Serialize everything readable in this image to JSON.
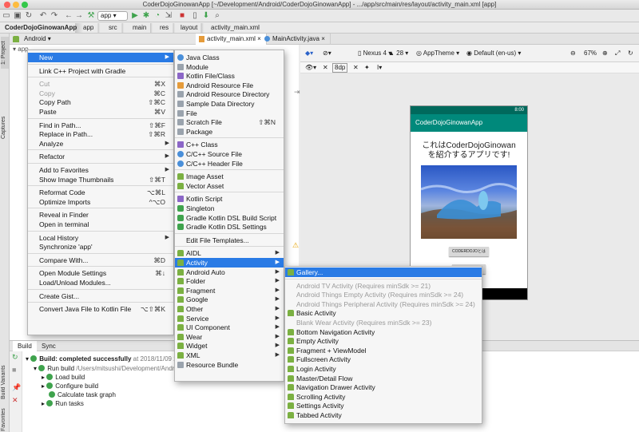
{
  "window": {
    "title": "CoderDojoGinowanApp [~/Development/Android/CoderDojoGinowanApp] - .../app/src/main/res/layout/activity_main.xml [app]"
  },
  "toolbar": {
    "run_config": "app"
  },
  "breadcrumbs": [
    "CoderDojoGinowanApp",
    "app",
    "src",
    "main",
    "res",
    "layout",
    "activity_main.xml"
  ],
  "left_strip": {
    "project": "1: Project",
    "captures": "Captures",
    "build_variants": "Build Variants",
    "favorites": "Favorites"
  },
  "project_panel": {
    "view_mode": "Android",
    "root": "app"
  },
  "editor_tabs": [
    "activity_main.xml",
    "MainActivity.java"
  ],
  "design_bar": {
    "device": "Nexus 4",
    "api": "28",
    "theme": "AppTheme",
    "locale": "Default (en-us)",
    "zoom": "67%",
    "margin": "8dp"
  },
  "preview": {
    "status_time": "8:00",
    "app_title": "CoderDojoGinowanApp",
    "hello_line1": "これはCoderDojoGinowan",
    "hello_line2": "を紹介するアプリです!",
    "button1": "CODERDOJOとは"
  },
  "bottom_tabs": [
    "Build",
    "Sync"
  ],
  "build_output": {
    "status": "Build: completed successfully",
    "status_time": "at 2018/11/09 20",
    "run_build": "Run build",
    "run_build_path": "/Users/mitsushi/Development/Andr",
    "steps": [
      "Load build",
      "Configure build",
      "Calculate task graph",
      "Run tasks"
    ]
  },
  "context_menu": [
    {
      "label": "New",
      "arrow": true,
      "highlight": true
    },
    {
      "sep": true
    },
    {
      "label": "Link C++ Project with Gradle"
    },
    {
      "sep": true
    },
    {
      "label": "Cut",
      "shortcut": "⌘X",
      "disabled": true
    },
    {
      "label": "Copy",
      "shortcut": "⌘C",
      "disabled": true
    },
    {
      "label": "Copy Path",
      "shortcut": "⇧⌘C"
    },
    {
      "label": "Paste",
      "shortcut": "⌘V"
    },
    {
      "sep": true
    },
    {
      "label": "Find in Path...",
      "shortcut": "⇧⌘F"
    },
    {
      "label": "Replace in Path...",
      "shortcut": "⇧⌘R"
    },
    {
      "label": "Analyze",
      "arrow": true
    },
    {
      "sep": true
    },
    {
      "label": "Refactor",
      "arrow": true
    },
    {
      "sep": true
    },
    {
      "label": "Add to Favorites",
      "arrow": true
    },
    {
      "label": "Show Image Thumbnails",
      "shortcut": "⇧⌘T"
    },
    {
      "sep": true
    },
    {
      "label": "Reformat Code",
      "shortcut": "⌥⌘L"
    },
    {
      "label": "Optimize Imports",
      "shortcut": "^⌥O"
    },
    {
      "sep": true
    },
    {
      "label": "Reveal in Finder"
    },
    {
      "label": "Open in terminal"
    },
    {
      "sep": true
    },
    {
      "label": "Local History",
      "arrow": true
    },
    {
      "label": "Synchronize 'app'"
    },
    {
      "sep": true
    },
    {
      "label": "Compare With...",
      "shortcut": "⌘D"
    },
    {
      "sep": true
    },
    {
      "label": "Open Module Settings",
      "shortcut": "⌘↓"
    },
    {
      "label": "Load/Unload Modules..."
    },
    {
      "sep": true
    },
    {
      "label": "Create Gist..."
    },
    {
      "sep": true
    },
    {
      "label": "Convert Java File to Kotlin File",
      "shortcut": "⌥⇧⌘K"
    }
  ],
  "new_menu": [
    {
      "label": "Java Class",
      "icon": "blue"
    },
    {
      "label": "Module",
      "icon": "gray"
    },
    {
      "label": "Kotlin File/Class",
      "icon": "purple"
    },
    {
      "label": "Android Resource File",
      "icon": "orange"
    },
    {
      "label": "Android Resource Directory",
      "icon": "gray"
    },
    {
      "label": "Sample Data Directory",
      "icon": "gray"
    },
    {
      "label": "File",
      "icon": "gray"
    },
    {
      "label": "Scratch File",
      "shortcut": "⇧⌘N",
      "icon": "gray"
    },
    {
      "label": "Package",
      "icon": "gray"
    },
    {
      "sep": true
    },
    {
      "label": "C++ Class",
      "icon": "purple"
    },
    {
      "label": "C/C++ Source File",
      "icon": "blue"
    },
    {
      "label": "C/C++ Header File",
      "icon": "blue"
    },
    {
      "sep": true
    },
    {
      "label": "Image Asset",
      "icon": "and"
    },
    {
      "label": "Vector Asset",
      "icon": "and"
    },
    {
      "sep": true
    },
    {
      "label": "Kotlin Script",
      "icon": "purple"
    },
    {
      "label": "Singleton",
      "icon": "green"
    },
    {
      "label": "Gradle Kotlin DSL Build Script",
      "icon": "green"
    },
    {
      "label": "Gradle Kotlin DSL Settings",
      "icon": "green"
    },
    {
      "sep": true
    },
    {
      "label": "Edit File Templates..."
    },
    {
      "sep": true
    },
    {
      "label": "AIDL",
      "arrow": true,
      "icon": "and"
    },
    {
      "label": "Activity",
      "arrow": true,
      "highlight": true,
      "icon": "and"
    },
    {
      "label": "Android Auto",
      "arrow": true,
      "icon": "and"
    },
    {
      "label": "Folder",
      "arrow": true,
      "icon": "and"
    },
    {
      "label": "Fragment",
      "arrow": true,
      "icon": "and"
    },
    {
      "label": "Google",
      "arrow": true,
      "icon": "and"
    },
    {
      "label": "Other",
      "arrow": true,
      "icon": "and"
    },
    {
      "label": "Service",
      "arrow": true,
      "icon": "and"
    },
    {
      "label": "UI Component",
      "arrow": true,
      "icon": "and"
    },
    {
      "label": "Wear",
      "arrow": true,
      "icon": "and"
    },
    {
      "label": "Widget",
      "arrow": true,
      "icon": "and"
    },
    {
      "label": "XML",
      "arrow": true,
      "icon": "and"
    },
    {
      "label": "Resource Bundle",
      "icon": "gray"
    }
  ],
  "activity_menu": [
    {
      "label": "Gallery...",
      "highlight": true,
      "icon": "and"
    },
    {
      "sep": true
    },
    {
      "label": "Android TV Activity (Requires minSdk >= 21)",
      "disabled": true
    },
    {
      "label": "Android Things Empty Activity (Requires minSdk >= 24)",
      "disabled": true
    },
    {
      "label": "Android Things Peripheral Activity (Requires minSdk >= 24)",
      "disabled": true
    },
    {
      "label": "Basic Activity",
      "icon": "and"
    },
    {
      "label": "Blank Wear Activity (Requires minSdk >= 23)",
      "disabled": true
    },
    {
      "label": "Bottom Navigation Activity",
      "icon": "and"
    },
    {
      "label": "Empty Activity",
      "icon": "and"
    },
    {
      "label": "Fragment + ViewModel",
      "icon": "and"
    },
    {
      "label": "Fullscreen Activity",
      "icon": "and"
    },
    {
      "label": "Login Activity",
      "icon": "and"
    },
    {
      "label": "Master/Detail Flow",
      "icon": "and"
    },
    {
      "label": "Navigation Drawer Activity",
      "icon": "and"
    },
    {
      "label": "Scrolling Activity",
      "icon": "and"
    },
    {
      "label": "Settings Activity",
      "icon": "and"
    },
    {
      "label": "Tabbed Activity",
      "icon": "and"
    }
  ],
  "colors": {
    "highlight": "#2a7be5",
    "appbar": "#00897b",
    "statusbar": "#00695c",
    "build_ok": "#3fa34d"
  }
}
